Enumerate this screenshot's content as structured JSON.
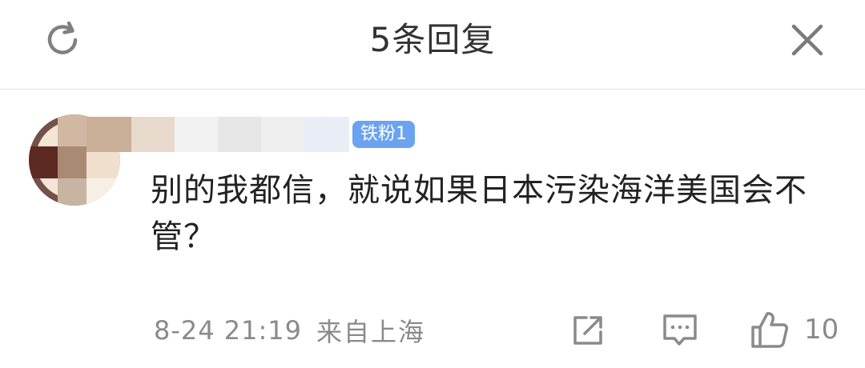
{
  "header": {
    "title": "5条回复",
    "refresh_icon": "refresh-icon",
    "close_icon": "close-icon"
  },
  "comment": {
    "badge": "铁粉1",
    "text": "别的我都信，就说如果日本污染海洋美国会不管？",
    "time": "8-24 21:19",
    "location": "来自上海",
    "like_count": "10",
    "icons": {
      "share": "share-icon",
      "reply": "reply-icon",
      "like": "thumbs-up-icon"
    }
  },
  "colors": {
    "badge": "#6aa3f0",
    "muted_text": "#8a8a8a",
    "body_text": "#222222",
    "icon_gray": "#8a8a8a"
  }
}
